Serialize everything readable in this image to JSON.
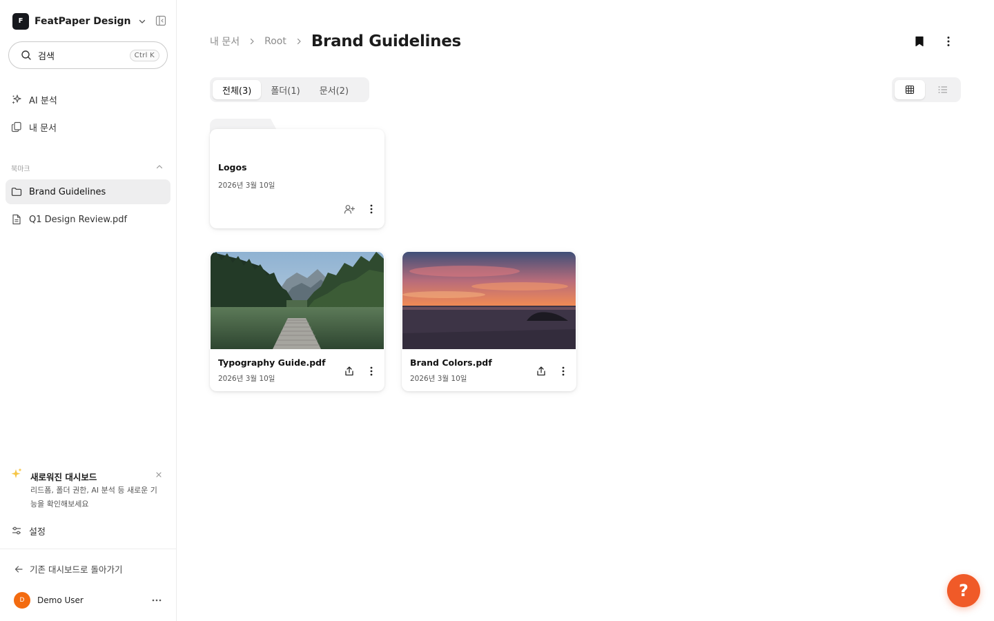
{
  "workspace": {
    "logo_letter": "F",
    "name": "FeatPaper Design"
  },
  "search": {
    "label": "검색",
    "shortcut": "Ctrl K"
  },
  "nav": [
    {
      "label": "AI 분석",
      "icon": "sparkles-icon"
    },
    {
      "label": "내 문서",
      "icon": "documents-icon"
    }
  ],
  "bookmarks": {
    "section_label": "북마크",
    "items": [
      {
        "label": "Brand Guidelines",
        "icon": "folder-icon",
        "active": true
      },
      {
        "label": "Q1 Design Review.pdf",
        "icon": "file-icon",
        "active": false
      }
    ]
  },
  "promo": {
    "title": "새로워진 대시보드",
    "description": "리드폼, 폴더 권한, AI 분석 등 새로운 기능을 확인해보세요"
  },
  "settings_label": "설정",
  "back_label": "기존 대시보드로 돌아가기",
  "user": {
    "initial": "D",
    "name": "Demo User"
  },
  "breadcrumb": {
    "items": [
      "내 문서",
      "Root"
    ],
    "current": "Brand Guidelines"
  },
  "tabs": [
    {
      "label": "전체(3)",
      "active": true
    },
    {
      "label": "폴더(1)",
      "active": false
    },
    {
      "label": "문서(2)",
      "active": false
    }
  ],
  "view_mode": "grid",
  "folders": [
    {
      "name": "Logos",
      "date": "2026년 3월 10일"
    }
  ],
  "documents": [
    {
      "name": "Typography Guide.pdf",
      "date": "2026년 3월 10일",
      "thumbnail": "lake-pier-mountains"
    },
    {
      "name": "Brand Colors.pdf",
      "date": "2026년 3월 10일",
      "thumbnail": "sunset-over-sea"
    }
  ],
  "help_label": "?",
  "colors": {
    "accent": "#f05a28",
    "avatar": "#f36b10",
    "active_bg": "#eeeeef"
  }
}
